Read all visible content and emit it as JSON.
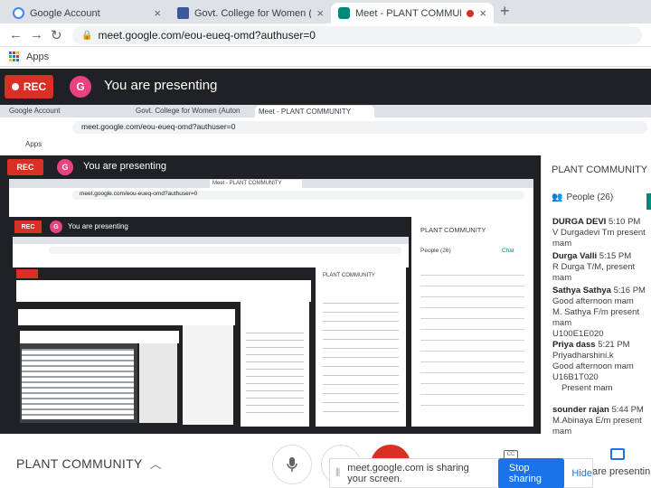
{
  "browser": {
    "tabs": [
      {
        "title": "Google Account",
        "fav_color": "#4285f4",
        "fav_label": "G"
      },
      {
        "title": "Govt. College for Women (Auton",
        "fav_color": "#3b5998",
        "fav_label": "18"
      },
      {
        "title": "Meet - PLANT COMMUNITY",
        "fav_color": "#00897b",
        "fav_label": ""
      }
    ],
    "url": "meet.google.com/eou-eueq-omd?authuser=0",
    "bookmark_apps": "Apps"
  },
  "presenting": {
    "rec_label": "REC",
    "avatar_letter": "G",
    "text": "You are presenting"
  },
  "nested": {
    "url": "meet.google.com/eou-eueq-omd?authuser=0",
    "tab1": "Google Account",
    "tab2": "Govt. College for Women (Auton",
    "tab3": "Meet - PLANT COMMUNITY",
    "apps": "Apps",
    "rec": "REC",
    "avatar": "G",
    "presenting": "You are presenting",
    "community": "PLANT COMMUNITY",
    "people": "People (26)",
    "chat": "Chat"
  },
  "side_panel": {
    "title": "PLANT COMMUNITY",
    "people_label": "People (26)",
    "messages": [
      {
        "sender": "DURGA DEVI",
        "time": "5:10 PM",
        "lines": [
          "V Durgadevi Tm present mam"
        ]
      },
      {
        "sender": "Durga Valli",
        "time": "5:15 PM",
        "lines": [
          "R Durga T/M, present mam"
        ]
      },
      {
        "sender": "Sathya Sathya",
        "time": "5:16 PM",
        "lines": [
          "Good afternoon mam",
          "M. Sathya F/m present mam",
          "U100E1E020"
        ]
      },
      {
        "sender": "Priya dass",
        "time": "5:21 PM",
        "lines": [
          "Priyadharshini.k",
          "Good afternoon mam",
          "U16B1T020",
          "Present mam"
        ]
      },
      {
        "sender": "sounder rajan",
        "time": "5:44 PM",
        "lines": [
          "M.Abinaya E/m present mam"
        ]
      }
    ]
  },
  "meeting_bar": {
    "name": "PLANT COMMUNITY",
    "share_notice": "meet.google.com is sharing your screen.",
    "stop_label": "Stop sharing",
    "hide_label": "Hide",
    "present_label": "are presentin"
  }
}
